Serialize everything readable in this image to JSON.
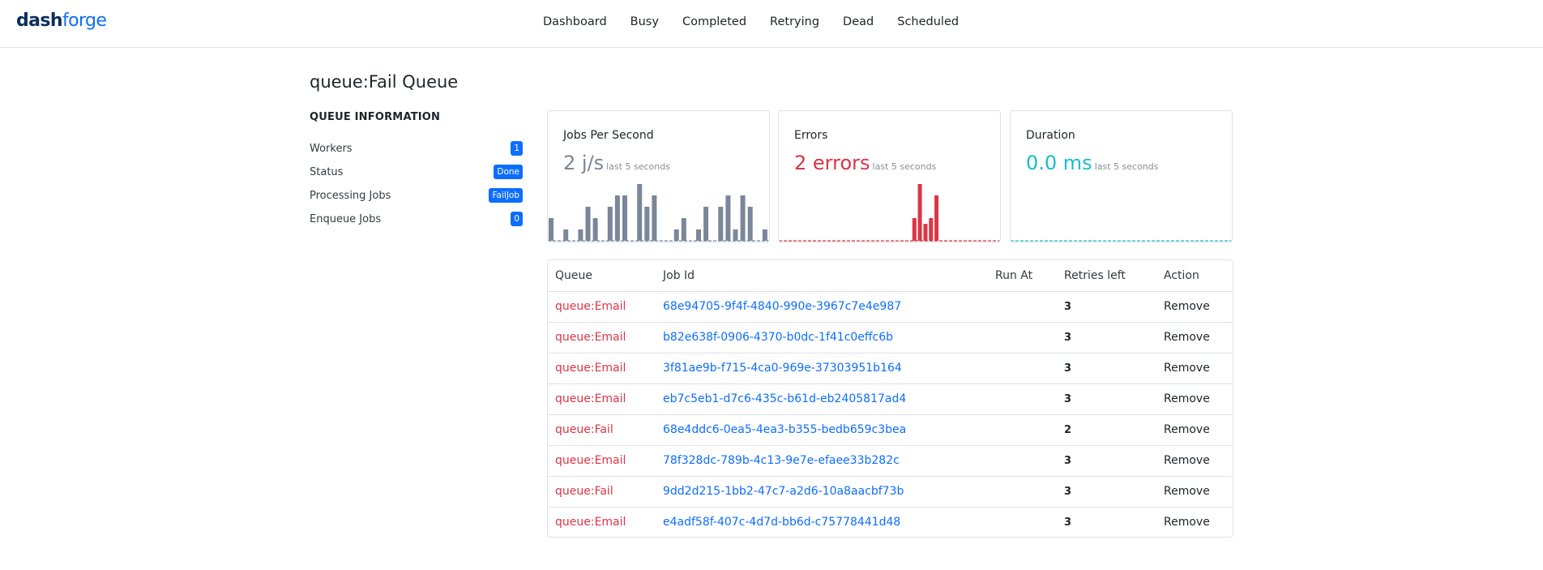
{
  "brand": {
    "part1": "dash",
    "part2": "forge"
  },
  "nav": [
    "Dashboard",
    "Busy",
    "Completed",
    "Retrying",
    "Dead",
    "Scheduled"
  ],
  "page": {
    "title": "queue:Fail Queue"
  },
  "queue_info": {
    "heading": "QUEUE INFORMATION",
    "rows": [
      {
        "label": "Workers",
        "value": "1"
      },
      {
        "label": "Status",
        "value": "Done"
      },
      {
        "label": "Processing Jobs",
        "value": "FailJob"
      },
      {
        "label": "Enqueue Jobs",
        "value": "0"
      }
    ]
  },
  "cards": {
    "jobs": {
      "title": "Jobs Per Second",
      "value": "2 j/s",
      "sub": "last 5 seconds",
      "color": "#7a869a"
    },
    "errors": {
      "title": "Errors",
      "value": "2 errors",
      "sub": "last 5 seconds",
      "color": "#dc3545"
    },
    "duration": {
      "title": "Duration",
      "value": "0.0 ms",
      "sub": "last 5 seconds",
      "color": "#17becf"
    }
  },
  "chart_data": [
    {
      "type": "bar",
      "series": [
        {
          "values": [
            2,
            0,
            1,
            0,
            1,
            3,
            2,
            0,
            3,
            4,
            4,
            0,
            5,
            3,
            4,
            0,
            0,
            1,
            2,
            0,
            1,
            3,
            0,
            3,
            4,
            1,
            4,
            3,
            0,
            1
          ]
        }
      ]
    },
    {
      "type": "bar",
      "series": [
        {
          "values": [
            0,
            0,
            0,
            0,
            0,
            0,
            0,
            0,
            0,
            0,
            0,
            0,
            0,
            0,
            0,
            0,
            0,
            0,
            0,
            0,
            0,
            0,
            0,
            0,
            2,
            5,
            1.5,
            2,
            4,
            0,
            0,
            0,
            0,
            0,
            0,
            0,
            0,
            0,
            0,
            0
          ]
        }
      ]
    },
    {
      "type": "bar",
      "series": [
        {
          "values": [
            0,
            0,
            0,
            0,
            0,
            0,
            0,
            0,
            0,
            0,
            0,
            0,
            0,
            0,
            0,
            0,
            0,
            0,
            0,
            0,
            0,
            0,
            0,
            0,
            0,
            0,
            0,
            0,
            0,
            0
          ]
        }
      ]
    }
  ],
  "table": {
    "headers": [
      "Queue",
      "Job Id",
      "Run At",
      "Retries left",
      "Action"
    ],
    "rows": [
      {
        "queue": "queue:Email",
        "job_id": "68e94705-9f4f-4840-990e-3967c7e4e987",
        "run_at": "",
        "retries": "3",
        "action": "Remove"
      },
      {
        "queue": "queue:Email",
        "job_id": "b82e638f-0906-4370-b0dc-1f41c0effc6b",
        "run_at": "",
        "retries": "3",
        "action": "Remove"
      },
      {
        "queue": "queue:Email",
        "job_id": "3f81ae9b-f715-4ca0-969e-37303951b164",
        "run_at": "",
        "retries": "3",
        "action": "Remove"
      },
      {
        "queue": "queue:Email",
        "job_id": "eb7c5eb1-d7c6-435c-b61d-eb2405817ad4",
        "run_at": "",
        "retries": "3",
        "action": "Remove"
      },
      {
        "queue": "queue:Fail",
        "job_id": "68e4ddc6-0ea5-4ea3-b355-bedb659c3bea",
        "run_at": "",
        "retries": "2",
        "action": "Remove"
      },
      {
        "queue": "queue:Email",
        "job_id": "78f328dc-789b-4c13-9e7e-efaee33b282c",
        "run_at": "",
        "retries": "3",
        "action": "Remove"
      },
      {
        "queue": "queue:Fail",
        "job_id": "9dd2d215-1bb2-47c7-a2d6-10a8aacbf73b",
        "run_at": "",
        "retries": "3",
        "action": "Remove"
      },
      {
        "queue": "queue:Email",
        "job_id": "e4adf58f-407c-4d7d-bb6d-c75778441d48",
        "run_at": "",
        "retries": "3",
        "action": "Remove"
      }
    ]
  }
}
